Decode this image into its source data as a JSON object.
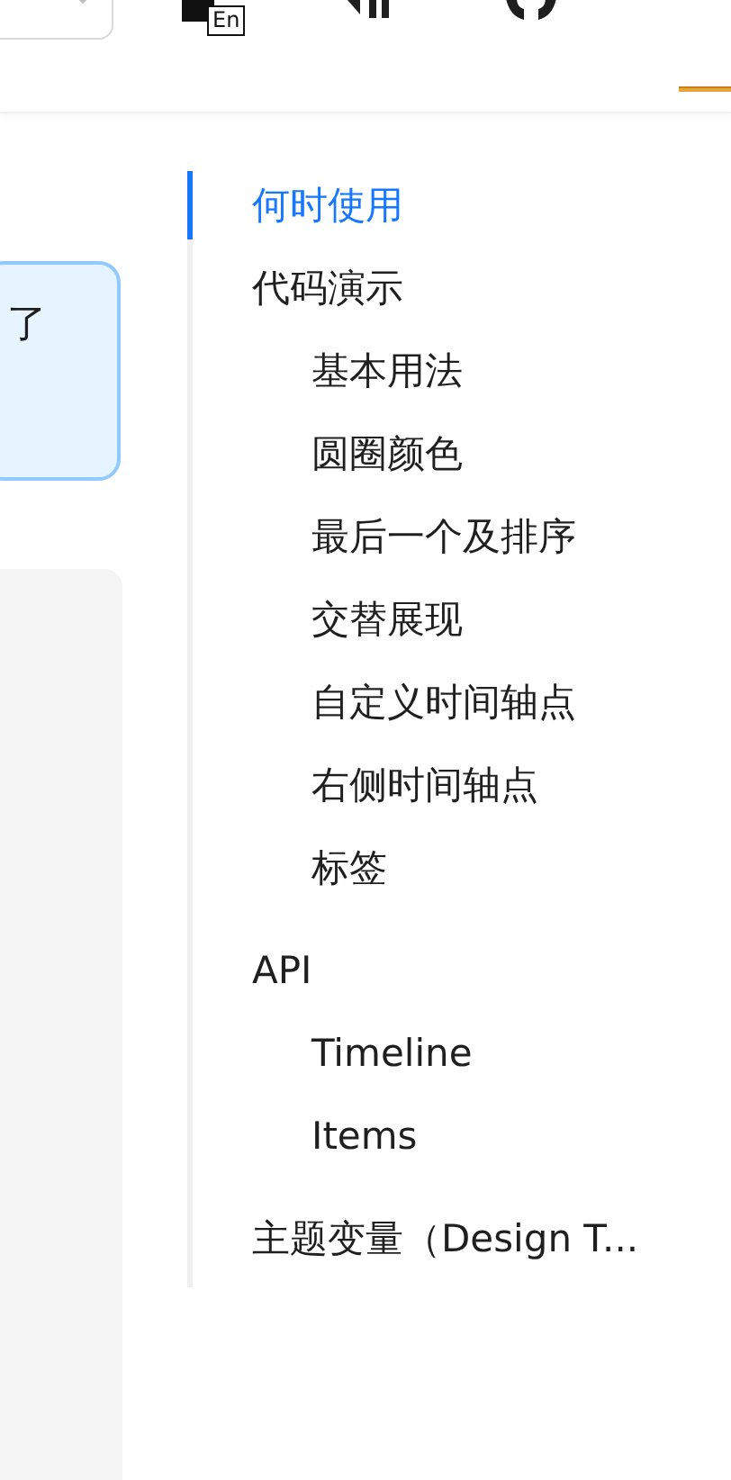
{
  "header": {
    "language_badge": "En"
  },
  "notice": {
    "text": "了"
  },
  "anchor": {
    "items": [
      {
        "label": "何时使用",
        "selected": true
      },
      {
        "label": "代码演示",
        "selected": false,
        "children": [
          {
            "label": "基本用法",
            "selected": false
          },
          {
            "label": "圆圈颜色",
            "selected": false
          },
          {
            "label": "最后一个及排序",
            "selected": false
          },
          {
            "label": "交替展现",
            "selected": false
          },
          {
            "label": "自定义时间轴点",
            "selected": false
          },
          {
            "label": "右侧时间轴点",
            "selected": false
          },
          {
            "label": "标签",
            "selected": false
          }
        ]
      },
      {
        "label": "API",
        "selected": false,
        "children": [
          {
            "label": "Timeline",
            "selected": false
          },
          {
            "label": "Items",
            "selected": false
          }
        ]
      },
      {
        "label": "主题变量（Design T...",
        "selected": false
      }
    ]
  }
}
